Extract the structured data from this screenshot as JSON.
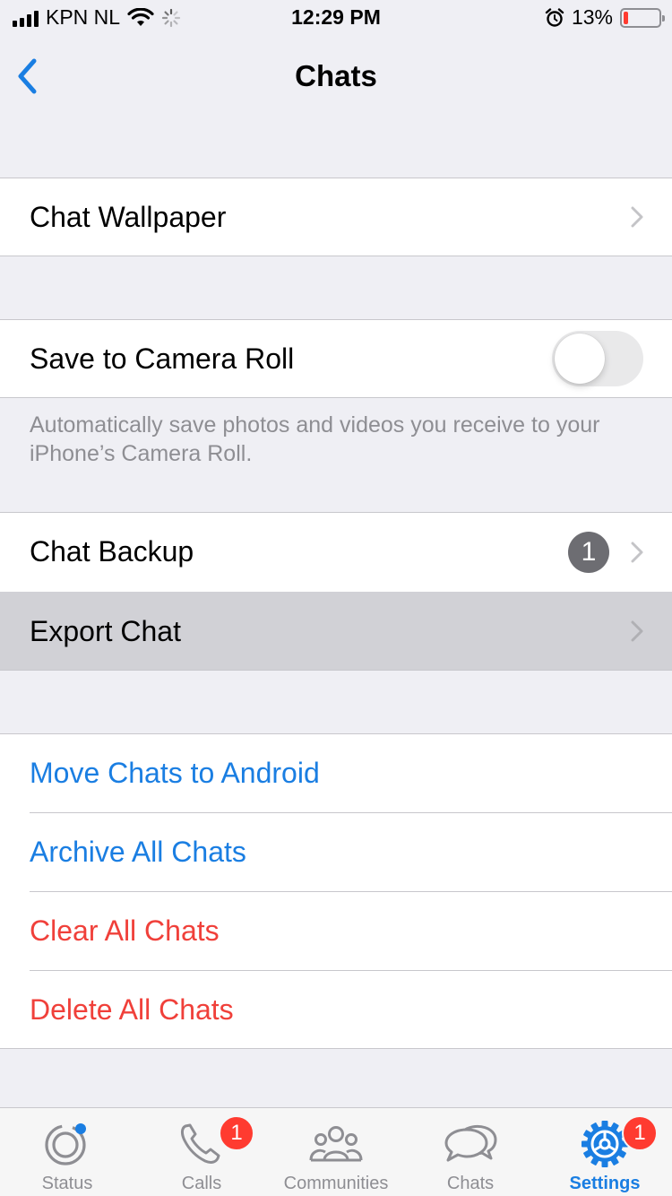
{
  "status_bar": {
    "carrier": "KPN NL",
    "time": "12:29 PM",
    "battery": "13%",
    "battery_level": 0.13,
    "icons": [
      "signal-icon",
      "wifi-icon",
      "loading-spinner-icon",
      "alarm-icon",
      "battery-icon"
    ]
  },
  "nav": {
    "title": "Chats",
    "back_icon": "chevron-left-icon"
  },
  "sections": {
    "wallpaper": {
      "label": "Chat Wallpaper"
    },
    "camera_roll": {
      "label": "Save to Camera Roll",
      "toggle_on": false,
      "footer": "Automatically save photos and videos you receive to your iPhone’s Camera Roll."
    },
    "backup": {
      "label": "Chat Backup",
      "badge": "1"
    },
    "export": {
      "label": "Export Chat"
    },
    "actions": {
      "move": "Move Chats to Android",
      "archive": "Archive All Chats",
      "clear": "Clear All Chats",
      "delete": "Delete All Chats"
    }
  },
  "tabbar": {
    "tabs": [
      {
        "label": "Status",
        "icon": "status-icon",
        "active": false
      },
      {
        "label": "Calls",
        "icon": "phone-icon",
        "badge": "1",
        "active": false
      },
      {
        "label": "Communities",
        "icon": "communities-icon",
        "active": false
      },
      {
        "label": "Chats",
        "icon": "chat-bubbles-icon",
        "active": false
      },
      {
        "label": "Settings",
        "icon": "settings-gear-icon",
        "badge": "1",
        "active": true
      }
    ]
  },
  "colors": {
    "accent": "#1a7ee2",
    "destructive": "#f0403a",
    "background": "#efeff4",
    "badge": "#ff3b30",
    "highlight": "#d1d1d6"
  }
}
